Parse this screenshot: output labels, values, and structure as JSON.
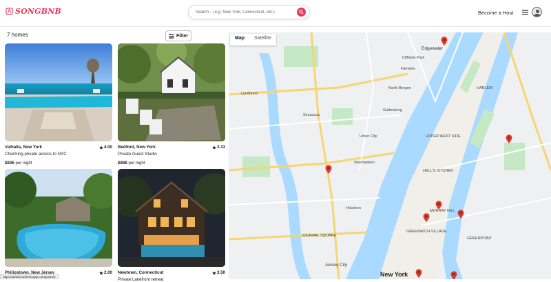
{
  "header": {
    "logo_text": "SONGBNB",
    "search_placeholder": "Search... (e.g. New York, Connecticut, etc.)",
    "become_host": "Become a Host"
  },
  "listing": {
    "count_label": "7 homes",
    "filter_label": "Filter",
    "homes": [
      {
        "location": "Valhalla, New York",
        "rating": "4.00",
        "subtitle": "Charming private access to NYC",
        "price": "$836",
        "per": "per night"
      },
      {
        "location": "Bedford, New York",
        "rating": "3.33",
        "subtitle": "Private Guest Studio",
        "price": "$888",
        "per": "per night"
      },
      {
        "location": "Philipstown, New Jersey",
        "rating": "2.00",
        "subtitle": "",
        "price": "",
        "per": ""
      },
      {
        "location": "Newtown, Connecticut",
        "rating": "3.50",
        "subtitle": "Private Lakefront retreat",
        "price": "",
        "per": ""
      }
    ]
  },
  "map": {
    "tabs": [
      "Map",
      "Satellite"
    ],
    "active_tab": "Map",
    "labels": {
      "new_york": "New York",
      "jersey_city": "Jersey City",
      "edgewater": "Edgewater",
      "cliffside_park": "Cliffside Park",
      "fairview": "Fairview",
      "north_bergen": "North Bergen",
      "guttenberg": "Guttenberg",
      "secaucus": "Secaucus",
      "union_city": "Union City",
      "weehawken": "Weehawken",
      "hoboken": "Hoboken",
      "lyndhurst": "Lyndhurst",
      "hells_kitchen": "HELL'S KITCHEN",
      "harlem": "HARLEM",
      "murray_hill": "MURRAY HILL",
      "greenwich_village": "GREENWICH VILLAGE",
      "greenpoint": "GREENPOINT",
      "journal_square": "JOURNAL SQUARE",
      "upper_west_side": "UPPER WEST SIDE"
    }
  },
  "status_bar": {
    "url": "https://airbnb.achievisupp.com/posts/3"
  },
  "colors": {
    "brand": "#e8385a",
    "pin": "#d93b30",
    "water": "#aadaff",
    "park": "#c5e8c5"
  }
}
